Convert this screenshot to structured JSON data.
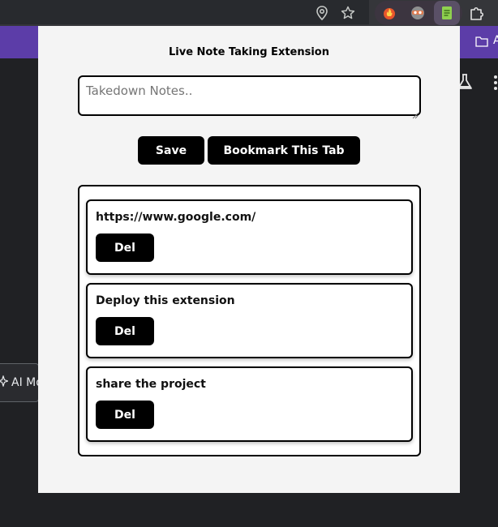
{
  "browser": {
    "bookmark_folder_label": "A",
    "ai_mode_label": "AI Mo",
    "toolbar_icons": [
      "location-icon",
      "star-icon",
      "extension-fire-icon",
      "extension-mask-icon",
      "extension-note-icon",
      "puzzle-icon"
    ]
  },
  "popup": {
    "title": "Live Note Taking Extension",
    "input_placeholder": "Takedown Notes..",
    "input_value": "",
    "save_label": "Save",
    "bookmark_label": "Bookmark This Tab",
    "notes": [
      {
        "text": "https://www.google.com/",
        "delete_label": "Del"
      },
      {
        "text": "Deploy this extension",
        "delete_label": "Del"
      },
      {
        "text": "share the project",
        "delete_label": "Del"
      }
    ]
  },
  "colors": {
    "bookmarks_bar": "#5c3da8",
    "page_background": "#202124",
    "popup_background": "#f4f4f4",
    "button": "#000000"
  }
}
